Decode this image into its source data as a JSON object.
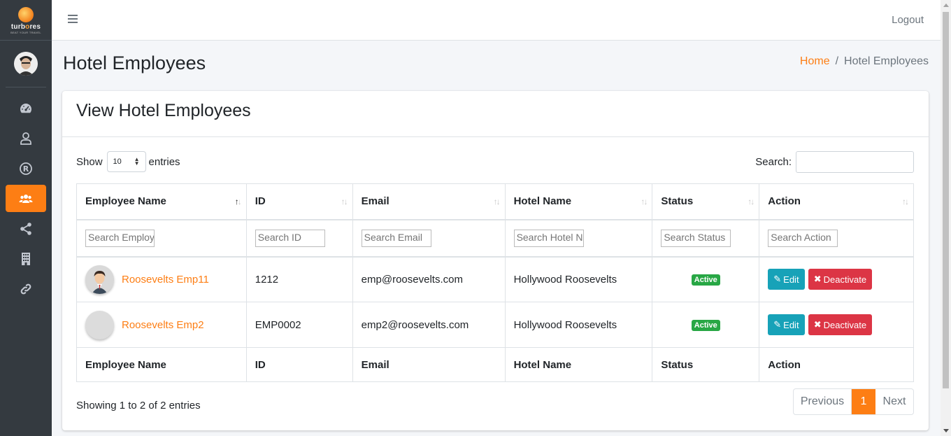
{
  "brand": {
    "name_part1": "turb",
    "name_o": "o",
    "name_part2": "res",
    "tagline": "BEAT YOUR TRAVEL"
  },
  "topnav": {
    "logout_label": "Logout"
  },
  "page": {
    "title": "Hotel Employees"
  },
  "breadcrumb": {
    "home": "Home",
    "separator": "/",
    "current": "Hotel Employees"
  },
  "card": {
    "title": "View Hotel Employees"
  },
  "length": {
    "show_label": "Show",
    "value": "10",
    "entries_label": "entries"
  },
  "search": {
    "label": "Search:",
    "value": ""
  },
  "table": {
    "columns": [
      "Employee Name",
      "ID",
      "Email",
      "Hotel Name",
      "Status",
      "Action"
    ],
    "filters": [
      "Search Employ",
      "Search ID",
      "Search Email",
      "Search Hotel N",
      "Search Status",
      "Search Action"
    ],
    "rows": [
      {
        "name": "Roosevelts Emp11",
        "id": "1212",
        "email": "emp@roosevelts.com",
        "hotel": "Hollywood Roosevelts",
        "status": "Active",
        "edit": "Edit",
        "deactivate": "Deactivate"
      },
      {
        "name": "Roosevelts Emp2",
        "id": "EMP0002",
        "email": "emp2@roosevelts.com",
        "hotel": "Hollywood Roosevelts",
        "status": "Active",
        "edit": "Edit",
        "deactivate": "Deactivate"
      }
    ]
  },
  "info": "Showing 1 to 2 of 2 entries",
  "pagination": {
    "previous": "Previous",
    "current": "1",
    "next": "Next"
  },
  "sidebar": {
    "icons": [
      "dashboard-icon",
      "user-icon",
      "registered-icon",
      "users-icon",
      "share-icon",
      "building-icon",
      "link-icon"
    ],
    "active_index": 3
  },
  "colors": {
    "accent": "#fd7e14",
    "sidebar": "#343a40",
    "edit": "#17a2b8",
    "deactivate": "#dc3545",
    "badge": "#28a745"
  }
}
